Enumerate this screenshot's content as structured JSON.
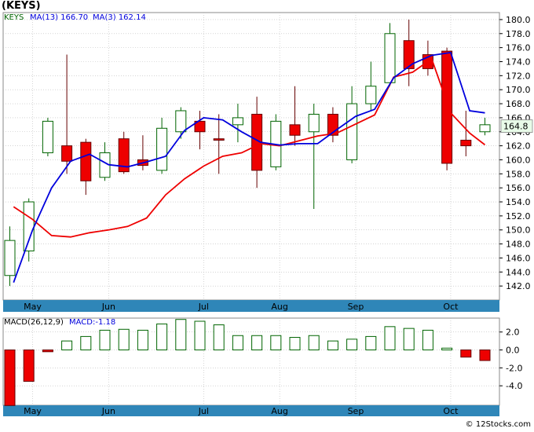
{
  "ticker_title": "(KEYS)",
  "footer": "© 12Stocks.com",
  "colors": {
    "up": "#ffffff",
    "down": "#ee0000",
    "upline": "#006400",
    "ma13": "#0000dd",
    "ma3": "#ee0000",
    "macd": "#006400",
    "axisbar": "#2f86b8",
    "grid": "#bbbbbb",
    "price_box": "#e8fbe8"
  },
  "chart_data": [
    {
      "type": "candlestick",
      "legend": {
        "symbol": "KEYS",
        "ma13_label": "MA(13)",
        "ma13_value": "166.70",
        "ma3_label": "MA(3)",
        "ma3_value": "162.14"
      },
      "ylim": [
        140,
        181
      ],
      "yticks": [
        "142.0",
        "144.0",
        "146.0",
        "148.0",
        "150.0",
        "152.0",
        "154.0",
        "156.0",
        "158.0",
        "160.0",
        "162.0",
        "164.0",
        "166.0",
        "168.0",
        "170.0",
        "172.0",
        "174.0",
        "176.0",
        "178.0",
        "180.0"
      ],
      "last_price": "164.8",
      "month_labels": [
        {
          "label": "May",
          "index": 1.2
        },
        {
          "label": "Jun",
          "index": 5.2
        },
        {
          "label": "Jul",
          "index": 10.2
        },
        {
          "label": "Aug",
          "index": 14.2
        },
        {
          "label": "Sep",
          "index": 18.2
        },
        {
          "label": "Oct",
          "index": 23.2
        }
      ],
      "candles": [
        {
          "o": 143.5,
          "h": 150.5,
          "l": 142.0,
          "c": 148.5
        },
        {
          "o": 147.0,
          "h": 154.5,
          "l": 145.5,
          "c": 154.0
        },
        {
          "o": 161.0,
          "h": 166.0,
          "l": 160.5,
          "c": 165.5
        },
        {
          "o": 162.0,
          "h": 175.0,
          "l": 158.0,
          "c": 159.8
        },
        {
          "o": 162.5,
          "h": 163.0,
          "l": 155.0,
          "c": 157.0
        },
        {
          "o": 157.5,
          "h": 162.5,
          "l": 157.0,
          "c": 161.0
        },
        {
          "o": 163.0,
          "h": 164.0,
          "l": 158.0,
          "c": 158.3
        },
        {
          "o": 160.0,
          "h": 163.5,
          "l": 158.5,
          "c": 159.2
        },
        {
          "o": 158.5,
          "h": 166.0,
          "l": 158.0,
          "c": 164.5
        },
        {
          "o": 164.0,
          "h": 167.5,
          "l": 163.0,
          "c": 167.0
        },
        {
          "o": 165.5,
          "h": 167.0,
          "l": 161.5,
          "c": 164.0
        },
        {
          "o": 163.0,
          "h": 166.5,
          "l": 158.0,
          "c": 162.8
        },
        {
          "o": 165.0,
          "h": 168.0,
          "l": 162.5,
          "c": 166.0
        },
        {
          "o": 166.5,
          "h": 169.0,
          "l": 156.0,
          "c": 158.5
        },
        {
          "o": 159.0,
          "h": 166.5,
          "l": 158.5,
          "c": 165.5
        },
        {
          "o": 165.0,
          "h": 170.5,
          "l": 162.0,
          "c": 163.5
        },
        {
          "o": 164.0,
          "h": 168.0,
          "l": 153.0,
          "c": 166.5
        },
        {
          "o": 166.5,
          "h": 167.5,
          "l": 162.5,
          "c": 163.5
        },
        {
          "o": 160.0,
          "h": 170.5,
          "l": 159.5,
          "c": 168.0
        },
        {
          "o": 168.0,
          "h": 174.0,
          "l": 167.0,
          "c": 170.5
        },
        {
          "o": 171.0,
          "h": 179.5,
          "l": 170.5,
          "c": 178.0
        },
        {
          "o": 177.0,
          "h": 180.0,
          "l": 170.5,
          "c": 173.0
        },
        {
          "o": 175.0,
          "h": 177.0,
          "l": 172.0,
          "c": 173.0
        },
        {
          "o": 175.5,
          "h": 176.0,
          "l": 158.5,
          "c": 159.5
        },
        {
          "o": 162.8,
          "h": 167.0,
          "l": 160.5,
          "c": 162.0
        },
        {
          "o": 164.0,
          "h": 166.0,
          "l": 163.5,
          "c": 165.0
        }
      ],
      "ma13": [
        142.5,
        150.0,
        156.0,
        159.8,
        160.8,
        159.3,
        159.6,
        160.0,
        160.4,
        161.5,
        164.0,
        166.0,
        167.0,
        165.0,
        166.5,
        167.3,
        167.5,
        167.5,
        167.2,
        166.8,
        166.5,
        166.0,
        165.5,
        165.0,
        166.8,
        166.7
      ],
      "ma13_xs": [
        0.2,
        1.2,
        2.2,
        3.2,
        4.2,
        5.2,
        6.2,
        6.8,
        7.8,
        8.8,
        9.8,
        10.8,
        11.8,
        12.8,
        13.8,
        14.8,
        15.8,
        16.8,
        17.8,
        18.8,
        19.8,
        20.8,
        21.8,
        22.8,
        23.8,
        25.0
      ],
      "ma13_path": [
        [
          0.2,
          142.5
        ],
        [
          1.2,
          150.0
        ],
        [
          2.2,
          156.0
        ],
        [
          3.2,
          159.8
        ],
        [
          4.2,
          160.8
        ],
        [
          5.2,
          159.3
        ],
        [
          6.2,
          159.0
        ],
        [
          7.0,
          159.6
        ],
        [
          8.0,
          160.4
        ],
        [
          9.0,
          164.0
        ],
        [
          10.0,
          166.0
        ],
        [
          11.0,
          166.0
        ],
        [
          12.0,
          164.5
        ],
        [
          13.0,
          162.5
        ],
        [
          14.0,
          162.0
        ],
        [
          15.0,
          162.3
        ],
        [
          16.0,
          162.5
        ],
        [
          17.0,
          163.2
        ],
        [
          18.0,
          165.0
        ],
        [
          19.0,
          166.2
        ],
        [
          20.0,
          166.5
        ],
        [
          21.0,
          167.0
        ],
        [
          22.0,
          167.2
        ],
        [
          23.0,
          167.0
        ],
        [
          24.0,
          166.8
        ],
        [
          25.0,
          166.7
        ]
      ],
      "ma13_path_bottom": [
        [
          0.2,
          142.5
        ],
        [
          1.2,
          150.0
        ],
        [
          2.2,
          156.0
        ],
        [
          3.2,
          159.8
        ],
        [
          4.2,
          160.8
        ],
        [
          5.2,
          159.3
        ],
        [
          6.2,
          159.0
        ]
      ],
      "ma3_path": [
        [
          0.2,
          153.3
        ],
        [
          1.2,
          151.5
        ],
        [
          2.2,
          149.2
        ],
        [
          3.2,
          149.0
        ],
        [
          4.2,
          149.6
        ],
        [
          5.2,
          150.0
        ],
        [
          6.2,
          150.5
        ],
        [
          7.2,
          151.7
        ],
        [
          8.2,
          155.0
        ],
        [
          9.2,
          157.3
        ],
        [
          10.2,
          159.1
        ],
        [
          11.2,
          160.5
        ],
        [
          12.2,
          161.0
        ],
        [
          13.2,
          162.3
        ],
        [
          14.2,
          162.0
        ],
        [
          15.2,
          162.7
        ],
        [
          16.2,
          163.4
        ],
        [
          17.2,
          163.8
        ],
        [
          18.2,
          165.1
        ],
        [
          19.2,
          166.4
        ],
        [
          20.2,
          171.8
        ],
        [
          21.2,
          172.5
        ],
        [
          22.2,
          174.4
        ],
        [
          23.2,
          166.7
        ],
        [
          24.2,
          163.8
        ],
        [
          25.0,
          162.14
        ]
      ],
      "blue_ma_path": [
        [
          0.2,
          142.5
        ],
        [
          1.2,
          150.0
        ],
        [
          2.2,
          156.0
        ],
        [
          3.2,
          159.8
        ],
        [
          4.2,
          160.8
        ],
        [
          5.2,
          159.3
        ],
        [
          6.2,
          159.0
        ],
        [
          7.2,
          159.7
        ],
        [
          8.2,
          160.5
        ],
        [
          9.2,
          164.2
        ],
        [
          10.2,
          166.0
        ],
        [
          11.2,
          165.7
        ],
        [
          12.2,
          164.0
        ],
        [
          13.2,
          162.5
        ],
        [
          14.2,
          162.1
        ],
        [
          15.2,
          162.3
        ],
        [
          16.2,
          162.3
        ],
        [
          17.2,
          164.3
        ],
        [
          18.2,
          166.2
        ],
        [
          19.2,
          167.2
        ],
        [
          20.2,
          171.7
        ],
        [
          21.2,
          173.7
        ],
        [
          22.2,
          174.9
        ],
        [
          23.2,
          175.3
        ],
        [
          24.2,
          167.0
        ],
        [
          25.0,
          166.7
        ]
      ]
    },
    {
      "type": "bar",
      "legend": {
        "label": "MACD(26,12,9)",
        "value_label": "MACD:",
        "value": "-1.18"
      },
      "ylim": [
        -6,
        3.2
      ],
      "yticks": [
        "2.0",
        "0.0",
        "-2.0",
        "-4.0"
      ],
      "ytick_values": [
        2,
        0,
        -2,
        -4
      ],
      "values": [
        -6.2,
        -3.5,
        -0.2,
        1.0,
        1.5,
        2.2,
        2.3,
        2.2,
        2.9,
        3.4,
        3.2,
        2.8,
        1.6,
        1.6,
        1.6,
        1.4,
        1.6,
        1.0,
        1.2,
        1.5,
        2.6,
        2.4,
        2.2,
        0.2,
        -0.8,
        -1.18
      ]
    }
  ]
}
